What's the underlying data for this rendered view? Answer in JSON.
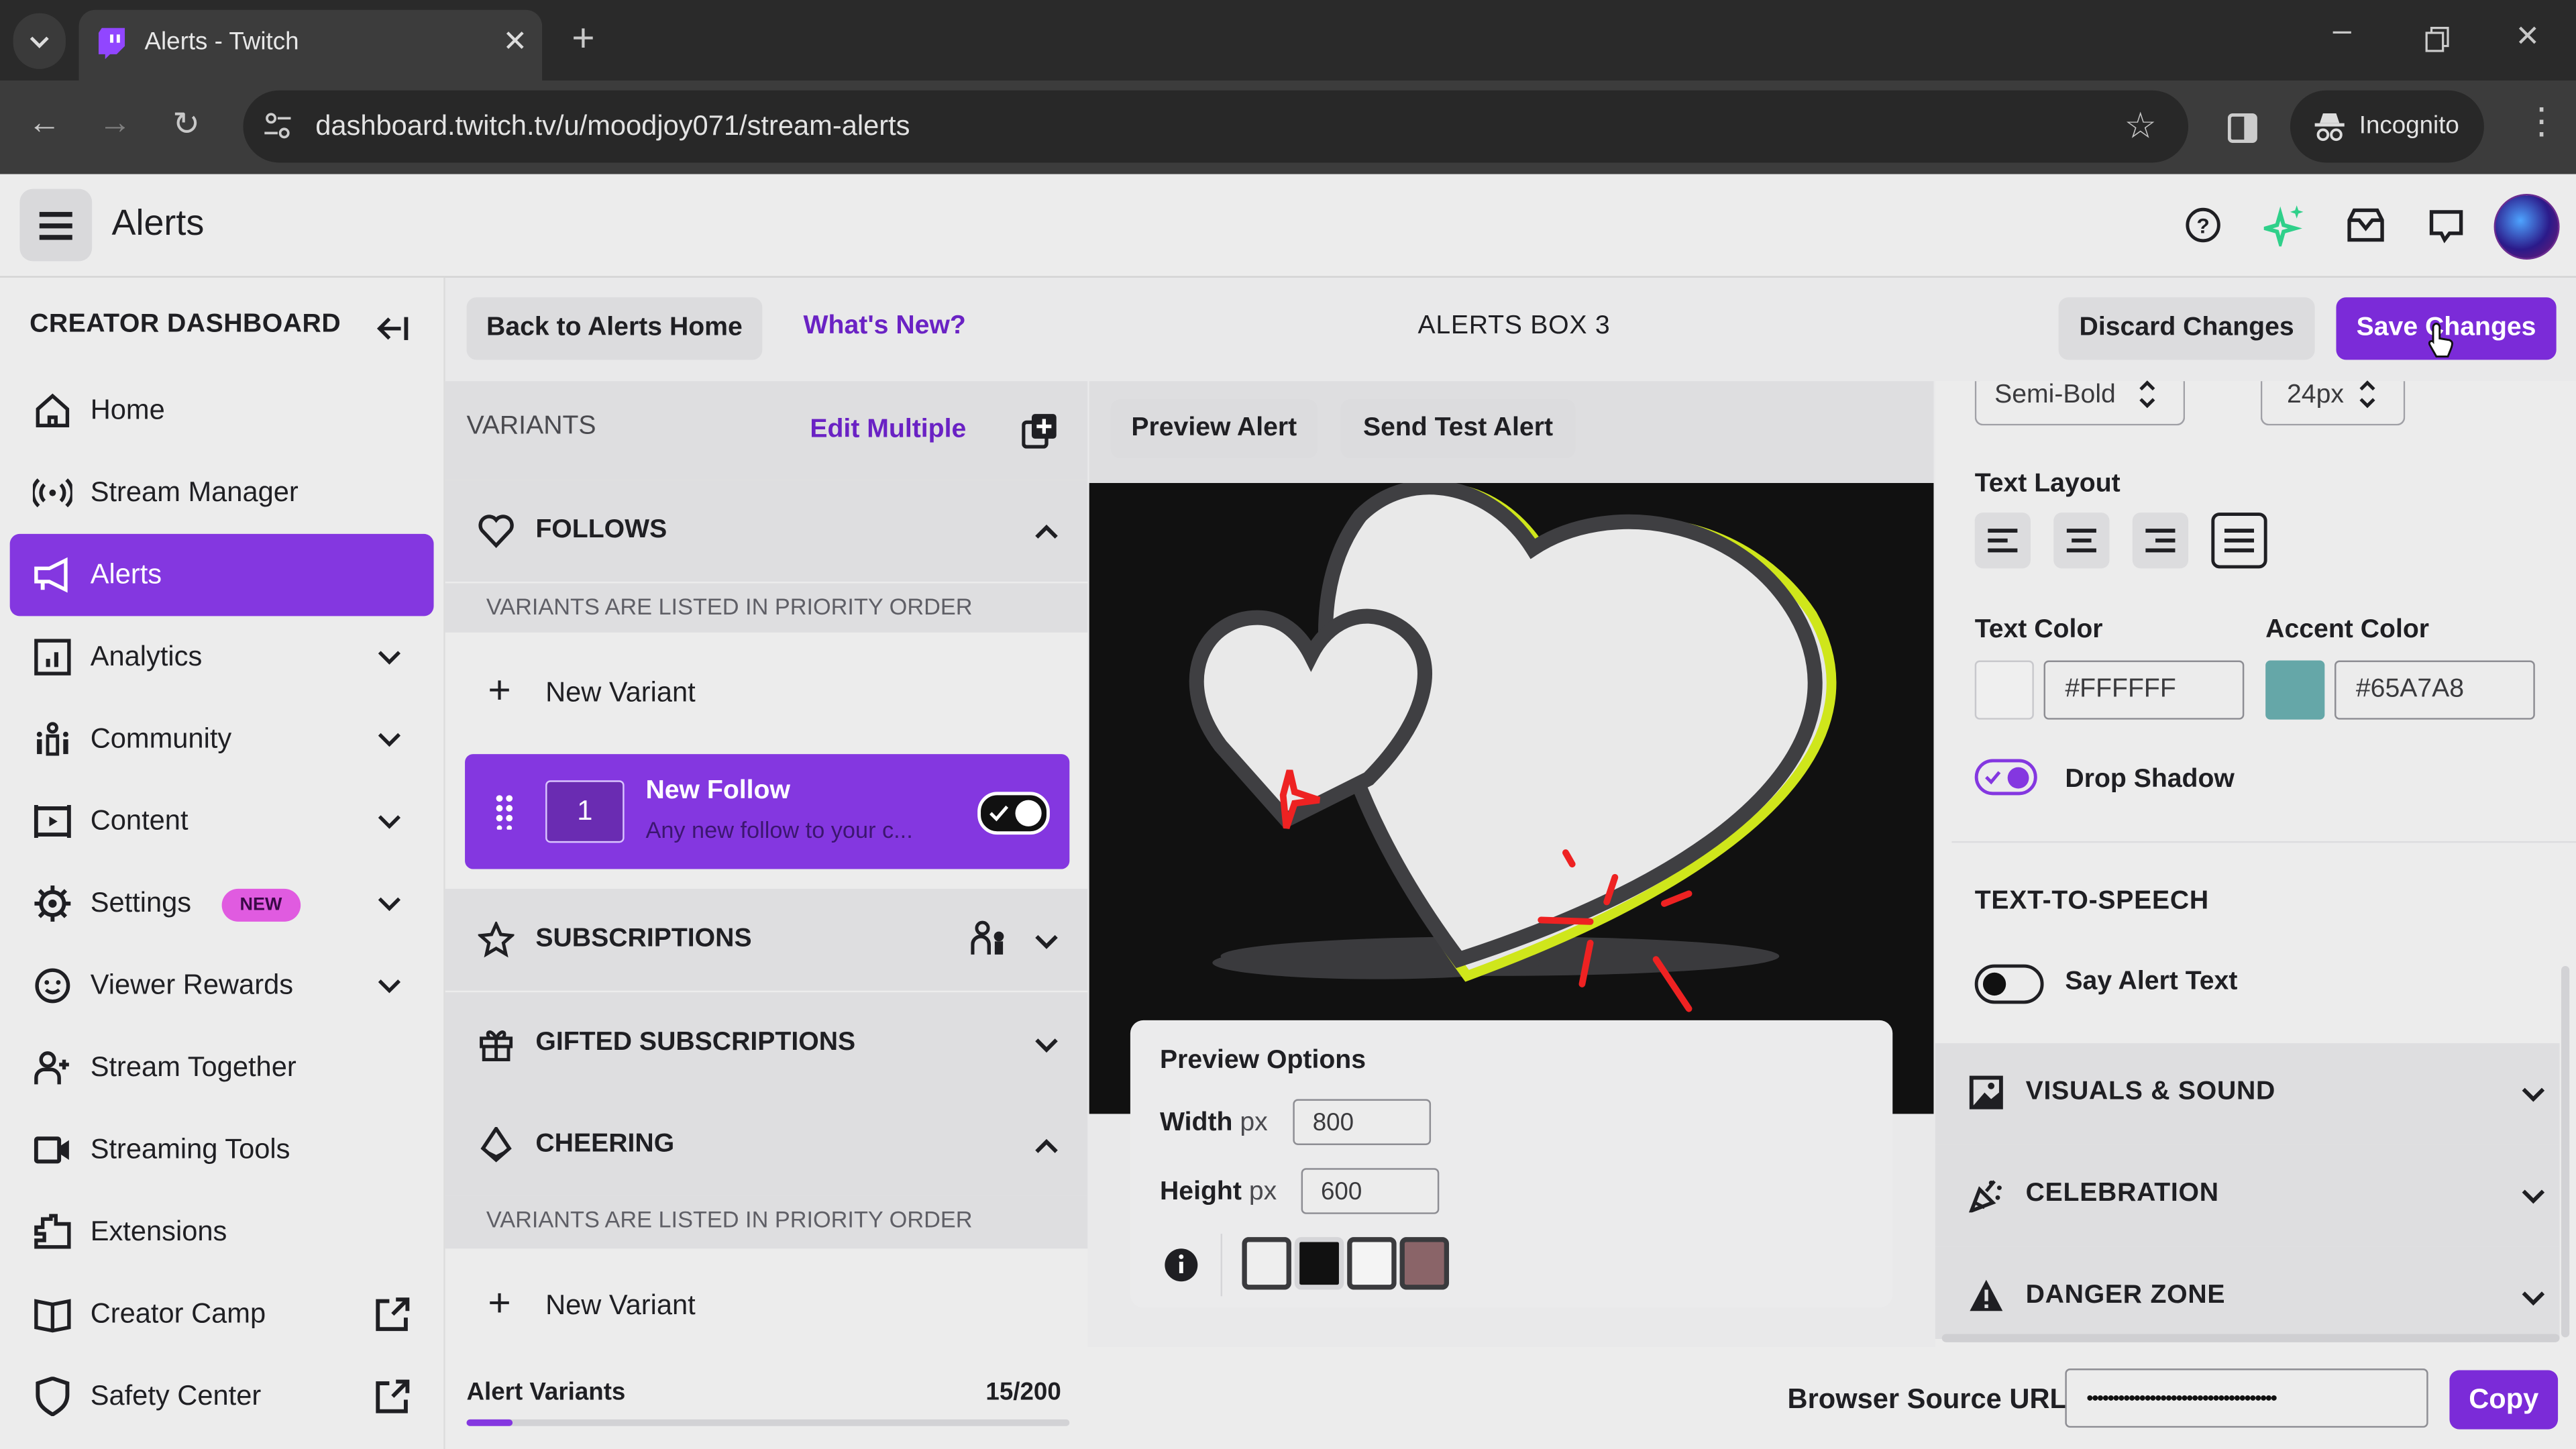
{
  "browser": {
    "tab_title": "Alerts - Twitch",
    "url": "dashboard.twitch.tv/u/moodjoy071/stream-alerts",
    "profile_label": "Incognito"
  },
  "app": {
    "title": "Alerts"
  },
  "sidebar": {
    "heading": "CREATOR DASHBOARD",
    "items": [
      {
        "label": "Home",
        "icon": "home-icon"
      },
      {
        "label": "Stream Manager",
        "icon": "broadcast-icon"
      },
      {
        "label": "Alerts",
        "icon": "megaphone-icon",
        "active": true
      },
      {
        "label": "Analytics",
        "icon": "analytics-icon",
        "expandable": true
      },
      {
        "label": "Community",
        "icon": "community-icon",
        "expandable": true
      },
      {
        "label": "Content",
        "icon": "content-icon",
        "expandable": true
      },
      {
        "label": "Settings",
        "icon": "gear-icon",
        "expandable": true,
        "badge": "NEW"
      },
      {
        "label": "Viewer Rewards",
        "icon": "smiley-icon",
        "expandable": true
      },
      {
        "label": "Stream Together",
        "icon": "add-user-icon"
      },
      {
        "label": "Streaming Tools",
        "icon": "camera-icon"
      },
      {
        "label": "Extensions",
        "icon": "puzzle-icon"
      },
      {
        "label": "Creator Camp",
        "icon": "book-icon",
        "external": true
      },
      {
        "label": "Safety Center",
        "icon": "shield-icon",
        "external": true
      }
    ]
  },
  "actions": {
    "back": "Back to Alerts Home",
    "whats_new": "What's New?",
    "box_title": "ALERTS BOX 3",
    "discard": "Discard Changes",
    "save": "Save Changes"
  },
  "variants": {
    "heading": "VARIANTS",
    "edit_multiple": "Edit Multiple",
    "priority_note": "VARIANTS ARE LISTED IN PRIORITY ORDER",
    "new_variant": "New Variant",
    "categories": {
      "follows": "FOLLOWS",
      "subscriptions": "SUBSCRIPTIONS",
      "gifted": "GIFTED SUBSCRIPTIONS",
      "cheering": "CHEERING"
    },
    "card": {
      "priority": "1",
      "title": "New Follow",
      "subtitle": "Any new follow to your c...",
      "enabled": true
    },
    "count_label": "Alert Variants",
    "count_value": "15/200",
    "count_fraction": 0.075
  },
  "preview": {
    "preview_alert": "Preview Alert",
    "send_test": "Send Test Alert",
    "options_title": "Preview Options",
    "width_label": "Width",
    "height_label": "Height",
    "unit": "px",
    "width_value": "800",
    "height_value": "600",
    "bg_swatches": [
      "#eeeeee",
      "#111111",
      "#f4f4f4",
      "#8a6468"
    ]
  },
  "settings": {
    "font_weight": "Semi-Bold",
    "font_size": "24px",
    "text_layout_label": "Text Layout",
    "text_layout_selected": "justify",
    "text_color_label": "Text Color",
    "text_color": "#FFFFFF",
    "accent_color_label": "Accent Color",
    "accent_color": "#65A7A8",
    "drop_shadow_label": "Drop Shadow",
    "drop_shadow": true,
    "tts_heading": "TEXT-TO-SPEECH",
    "say_alert_label": "Say Alert Text",
    "say_alert": false,
    "sections": [
      "VISUALS & SOUND",
      "CELEBRATION",
      "DANGER ZONE"
    ]
  },
  "footer": {
    "source_label": "Browser Source URL",
    "source_value": "••••••••••••••••••••••••••••••••••••",
    "copy": "Copy"
  },
  "colors": {
    "brand_purple": "#8437e0",
    "new_badge": "#e05be0",
    "sparkle_green": "#2fd08a"
  }
}
